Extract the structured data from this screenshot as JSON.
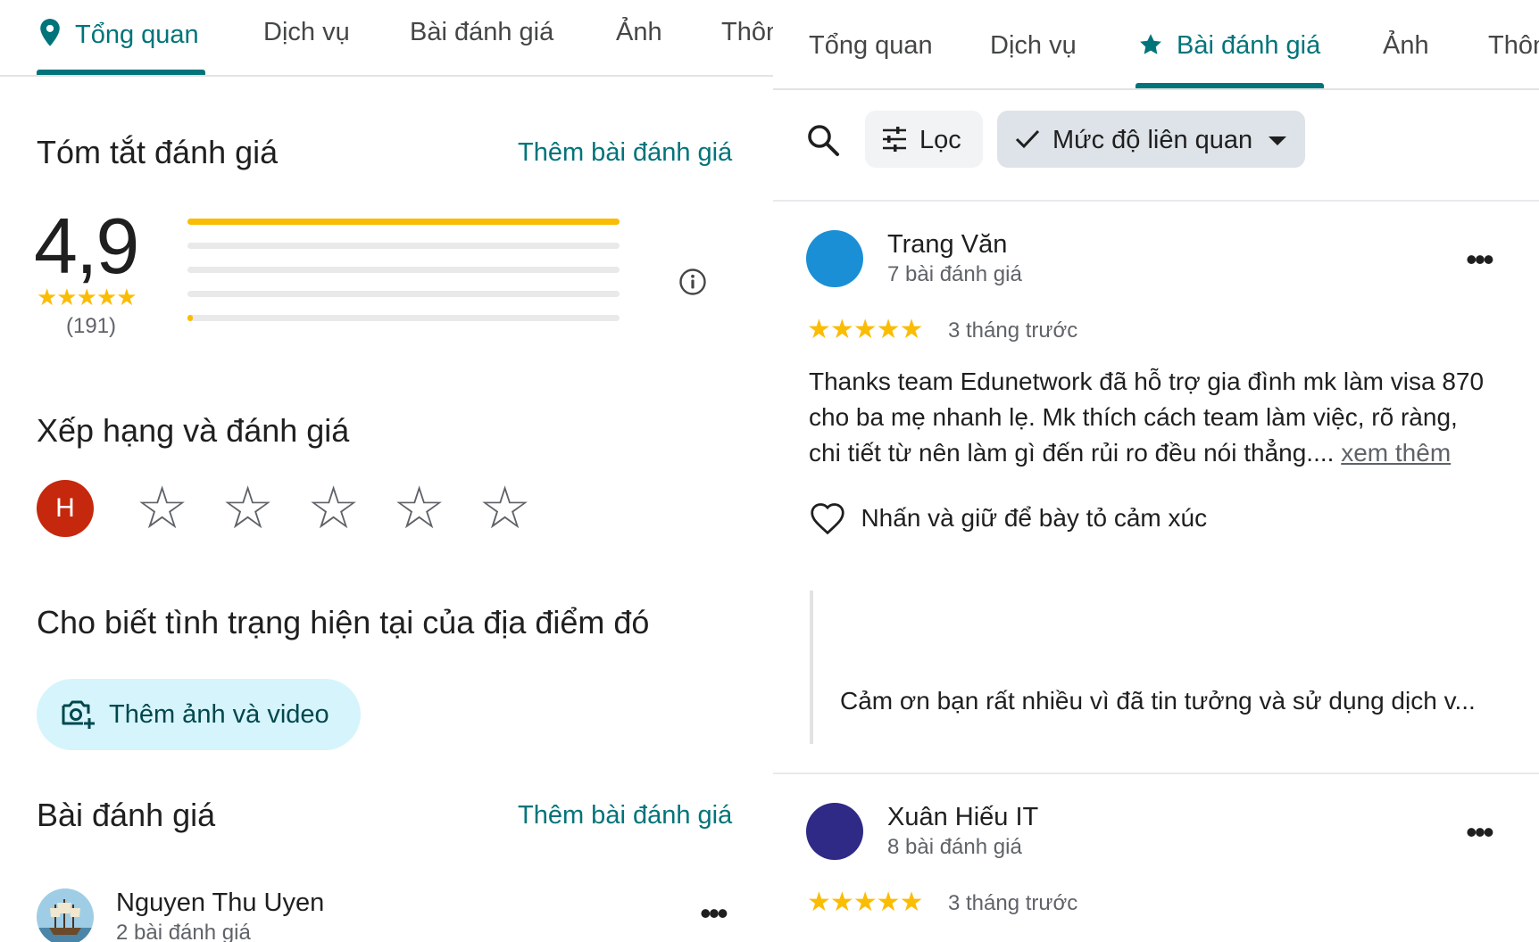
{
  "left": {
    "tabs": [
      {
        "label": "Tổng quan",
        "active": true
      },
      {
        "label": "Dịch vụ"
      },
      {
        "label": "Bài đánh giá"
      },
      {
        "label": "Ảnh"
      },
      {
        "label": "Thôn"
      }
    ],
    "summary": {
      "title": "Tóm tắt đánh giá",
      "add_review": "Thêm bài đánh giá",
      "rating": "4,9",
      "stars": "★★★★★",
      "count": "(191)",
      "distribution": [
        1.0,
        0.0,
        0.0,
        0.0,
        0.01
      ]
    },
    "rate": {
      "title": "Xếp hạng và đánh giá",
      "avatar_letter": "H",
      "empty_star": "☆"
    },
    "status": {
      "title": "Cho biết tình trạng hiện tại của địa điểm đó",
      "add_media": "Thêm ảnh và video"
    },
    "reviews": {
      "title": "Bài đánh giá",
      "add_review": "Thêm bài đánh giá",
      "first": {
        "name": "Nguyen Thu Uyen",
        "count": "2 bài đánh giá"
      }
    }
  },
  "right": {
    "tabs": [
      {
        "label": "Tổng quan"
      },
      {
        "label": "Dịch vụ"
      },
      {
        "label": "Bài đánh giá",
        "active": true
      },
      {
        "label": "Ảnh"
      },
      {
        "label": "Thôn"
      }
    ],
    "filter_label": "Lọc",
    "sort_label": "Mức độ liên quan",
    "reviews": [
      {
        "name": "Trang Văn",
        "count": "7 bài đánh giá",
        "avatar_color": "#1a8fd6",
        "stars": "★★★★★",
        "time": "3 tháng trước",
        "text_lines": [
          "Thanks team Edunetwork đã hỗ trợ gia đình mk làm visa 870",
          "cho ba mẹ nhanh lẹ. Mk thích cách team làm việc, rõ ràng,",
          "chi tiết từ nên làm gì đến rủi ro đều nói thẳng...."
        ],
        "more": "xem thêm",
        "react": "Nhấn và giữ để bày tỏ cảm xúc",
        "owner_reply": "Cảm ơn bạn rất nhiều vì đã tin tưởng và sử dụng dịch v..."
      },
      {
        "name": "Xuân Hiếu IT",
        "count": "8 bài đánh giá",
        "avatar_color": "#2e2a86",
        "stars": "★★★★★",
        "time": "3 tháng trước"
      }
    ]
  },
  "colors": {
    "accent": "#00747a",
    "star": "#fbbc04",
    "rater_avatar": "#c5280c",
    "media_button_bg": "#d6f4fb",
    "chip_bg": "#f1f3f4",
    "chip_selected_bg": "#dde3e8"
  }
}
